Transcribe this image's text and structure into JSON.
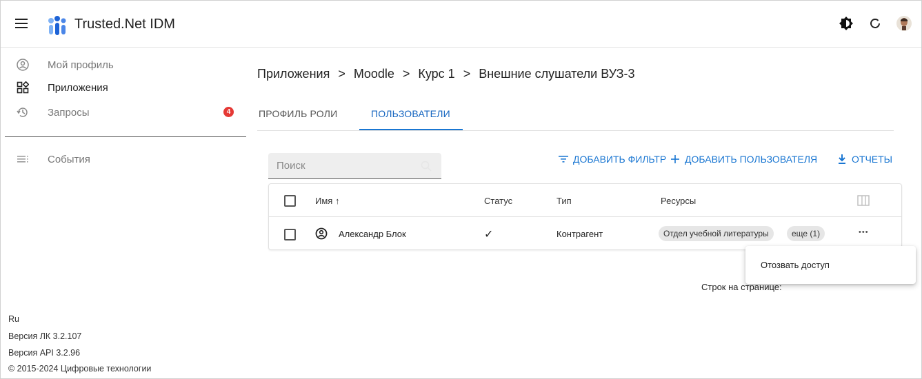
{
  "app": {
    "title": "Trusted.Net IDM"
  },
  "topbar": {
    "icons": [
      "theme-toggle-icon",
      "refresh-icon",
      "user-avatar"
    ]
  },
  "sidebar": {
    "items": [
      {
        "label": "Мой профиль",
        "icon": "account-circle-icon"
      },
      {
        "label": "Приложения",
        "icon": "apps-icon"
      },
      {
        "label": "Запросы",
        "icon": "history-icon",
        "badge": "4"
      },
      {
        "label": "События",
        "icon": "list-icon"
      }
    ],
    "footer": {
      "lang": "Ru",
      "lk_version": "Версия ЛК 3.2.107",
      "api_version": "Версия API 3.2.96",
      "copyright": "© 2015-2024 Цифровые технологии"
    }
  },
  "breadcrumb": {
    "items": [
      "Приложения",
      "Moodle",
      "Курс 1",
      "Внешние слушатели ВУЗ-3"
    ],
    "separator": ">"
  },
  "tabs": [
    {
      "label": "ПРОФИЛЬ РОЛИ",
      "active": false
    },
    {
      "label": "ПОЛЬЗОВАТЕЛИ",
      "active": true
    }
  ],
  "search": {
    "placeholder": "Поиск",
    "value": ""
  },
  "actions": {
    "add_filter": "ДОБАВИТЬ ФИЛЬТР",
    "add_user": "ДОБАВИТЬ ПОЛЬЗОВАТЕЛЯ",
    "reports": "ОТЧЕТЫ"
  },
  "table": {
    "columns": {
      "name": "Имя",
      "status": "Статус",
      "type": "Тип",
      "resources": "Ресурсы"
    },
    "sort_indicator": "↑",
    "rows": [
      {
        "name": "Александр Блок",
        "status": "✓",
        "type": "Контрагент",
        "resources": [
          "Отдел учебной литературы",
          "еще (1)"
        ],
        "menu": "•••"
      }
    ]
  },
  "row_menu": {
    "items": [
      "Отозвать доступ"
    ]
  },
  "pagination": {
    "label": "Строк на странице:"
  },
  "colors": {
    "accent": "#1976d2",
    "badge": "#e53935",
    "logo_blue": "#1e63d6"
  }
}
